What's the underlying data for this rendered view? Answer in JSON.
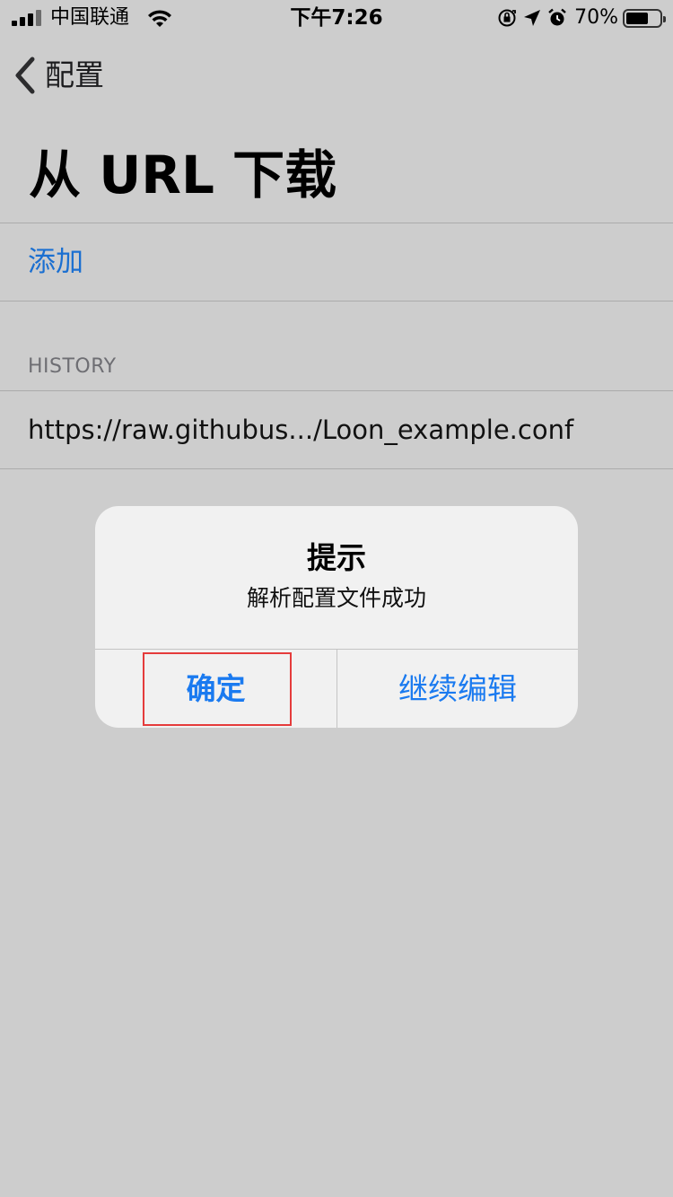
{
  "status_bar": {
    "carrier": "中国联通",
    "time": "下午7:26",
    "battery_percent": "70%",
    "battery_level": 0.7,
    "icons": [
      "signal-icon",
      "wifi-icon",
      "orientation-lock-icon",
      "location-icon",
      "alarm-icon",
      "battery-icon"
    ]
  },
  "nav": {
    "back_label": "配置",
    "title": "从 URL 下载"
  },
  "list": {
    "add_label": "添加",
    "history_header": "HISTORY",
    "history_items": [
      {
        "url": "https://raw.githubus.../Loon_example.conf"
      }
    ]
  },
  "alert": {
    "title": "提示",
    "message": "解析配置文件成功",
    "confirm_label": "确定",
    "edit_label": "继续编辑"
  },
  "colors": {
    "background": "#cdcdcd",
    "link_blue": "#1a6fd1",
    "button_blue": "#1a7af0",
    "highlight_red": "#e53b3b"
  }
}
